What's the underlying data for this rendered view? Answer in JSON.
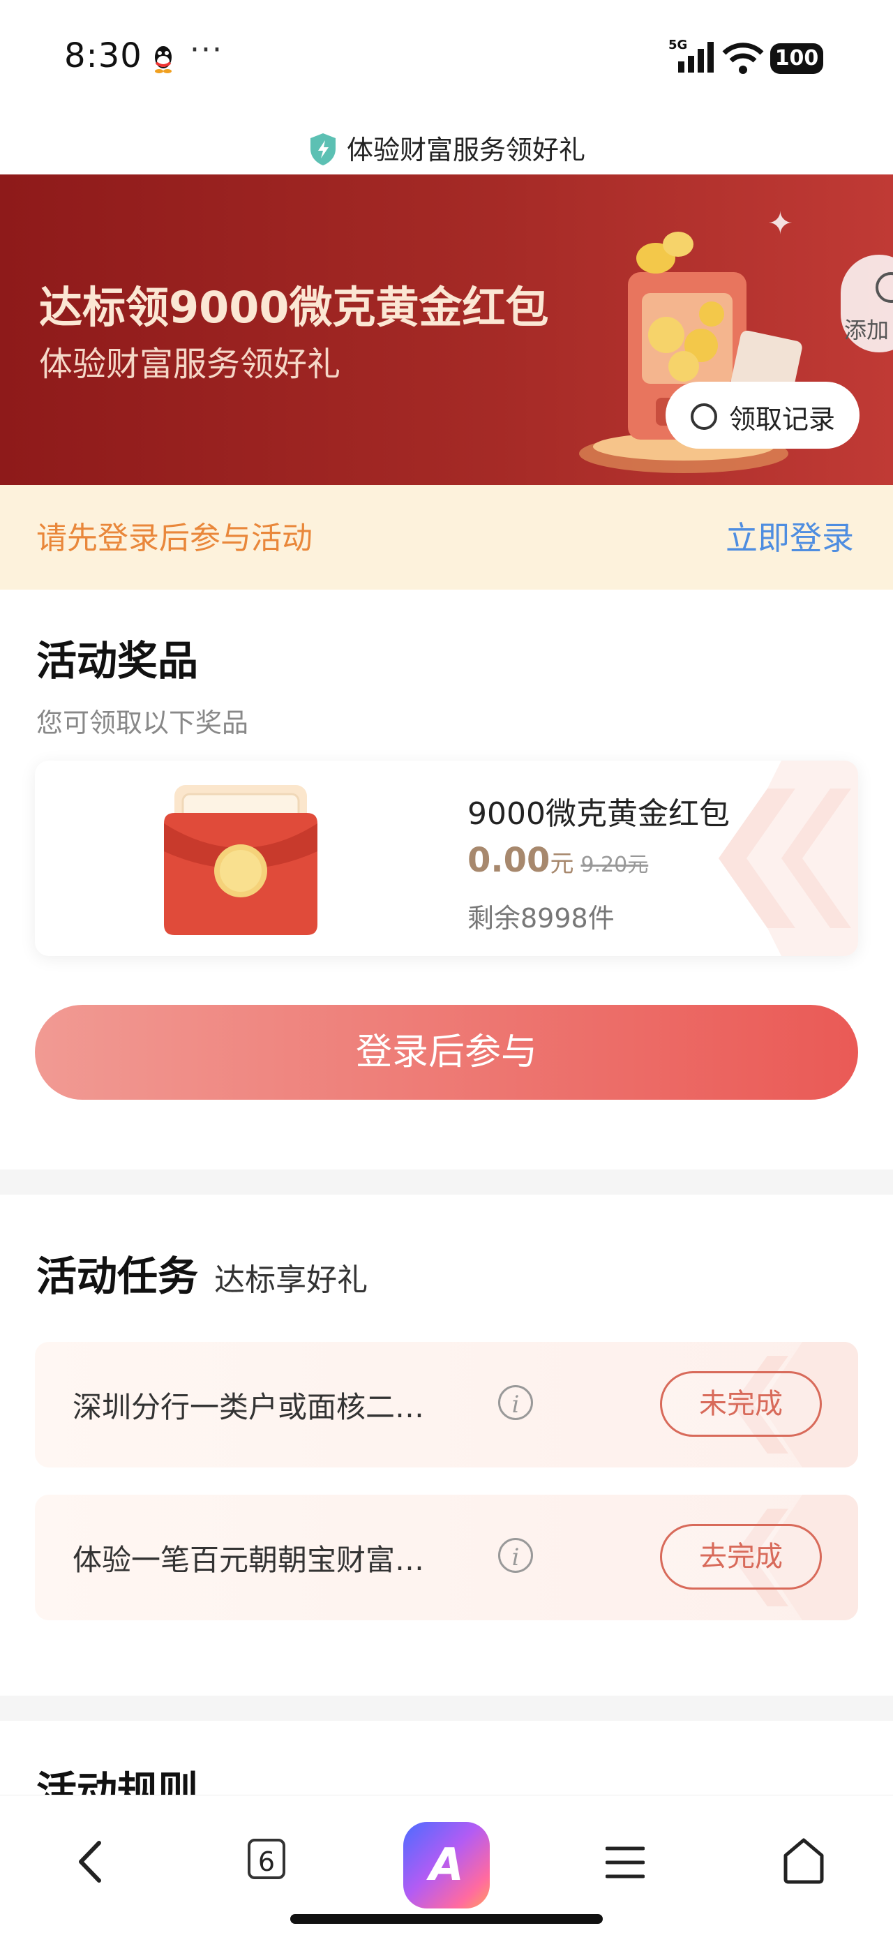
{
  "status_bar": {
    "time": "8:30",
    "more": "···",
    "network": "5G",
    "battery": "100"
  },
  "page": {
    "title": "体验财富服务领好礼"
  },
  "banner": {
    "headline": "达标领9000微克黄金红包",
    "subtitle": "体验财富服务领好礼",
    "add_label": "添加",
    "record_label": "领取记录"
  },
  "login_notice": {
    "text": "请先登录后参与活动",
    "link": "立即登录"
  },
  "prizes": {
    "title": "活动奖品",
    "subtitle": "您可领取以下奖品",
    "item": {
      "name": "9000微克黄金红包",
      "price": "0.00",
      "unit": "元",
      "original_price": "9.20元",
      "stock": "剩余8998件"
    },
    "join_button": "登录后参与"
  },
  "tasks": {
    "title": "活动任务",
    "subtitle": "达标享好礼",
    "items": [
      {
        "text": "深圳分行一类户或面核二…",
        "info": "i",
        "status": "未完成"
      },
      {
        "text": "体验一笔百元朝朝宝财富…",
        "info": "i",
        "status": "去完成"
      }
    ]
  },
  "rules": {
    "title": "活动规则"
  },
  "bottom_nav": {
    "tab_count": "6",
    "ai_label": "A"
  },
  "colors": {
    "banner_bg": "#9b2320",
    "notice_bg": "#fdf2dc",
    "notice_text": "#e9873a",
    "link": "#4e8de0",
    "join_button": "#ea5a56",
    "task_button": "#d86a5a",
    "price": "#a7886d"
  }
}
